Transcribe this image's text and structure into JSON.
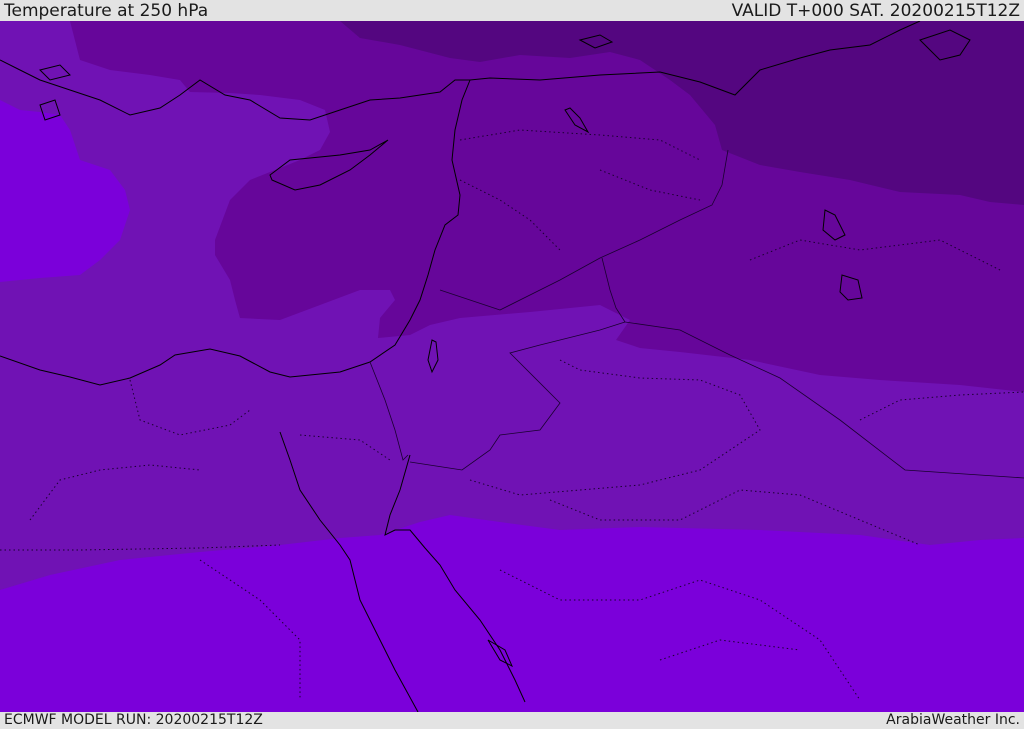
{
  "header": {
    "title": "Temperature at 250 hPa",
    "valid_time": "VALID T+000 SAT. 20200215T12Z"
  },
  "footer": {
    "model_run": "ECMWF MODEL RUN: 20200215T12Z",
    "credit": "ArabiaWeather Inc."
  },
  "map": {
    "colors": {
      "band_warmest": "#7b00da",
      "band_mid": "#7012b4",
      "band_cool": "#66069a",
      "band_coldest": "#540680",
      "coastline": "#000000",
      "border": "#1a0030"
    }
  }
}
